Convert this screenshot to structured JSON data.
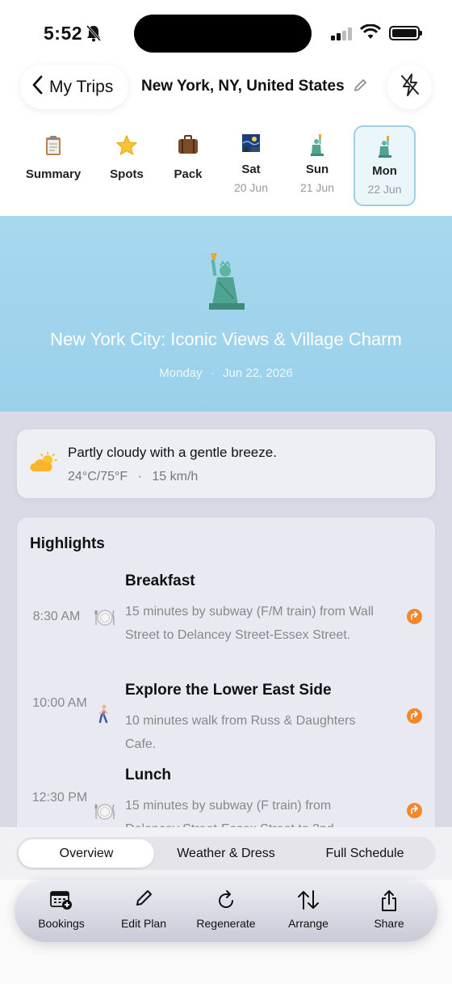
{
  "status_bar": {
    "time": "5:52"
  },
  "nav": {
    "back_label": "My Trips",
    "trip_title": "New York, NY, United States"
  },
  "tabs": [
    {
      "label": "Summary",
      "icon": "clipboard-icon"
    },
    {
      "label": "Spots",
      "icon": "star-icon"
    },
    {
      "label": "Pack",
      "icon": "suitcase-icon"
    },
    {
      "label": "Sat",
      "date": "20 Jun",
      "icon": "night-painting-icon"
    },
    {
      "label": "Sun",
      "date": "21 Jun",
      "icon": "statue-of-liberty-icon"
    },
    {
      "label": "Mon",
      "date": "22 Jun",
      "icon": "statue-of-liberty-icon",
      "active": true
    }
  ],
  "hero": {
    "title": "New York City: Iconic Views & Village Charm",
    "day": "Monday",
    "separator": "·",
    "date": "Jun 22, 2026",
    "background_color": "#9ad1ea"
  },
  "weather": {
    "description": "Partly cloudy with a gentle breeze.",
    "temperature": "24°C/75°F",
    "separator": "·",
    "wind": "15 km/h"
  },
  "highlights": {
    "title": "Highlights",
    "items": [
      {
        "time": "8:30 AM",
        "icon": "plate-icon",
        "name": "Breakfast",
        "description": "15 minutes by subway (F/M train) from Wall Street to Delancey Street-Essex Street."
      },
      {
        "time": "10:00 AM",
        "icon": "walking-person-icon",
        "name": "Explore the Lower East Side",
        "description": "10 minutes walk from Russ & Daughters Cafe."
      },
      {
        "time": "12:30 PM",
        "icon": "plate-icon",
        "name": "Lunch",
        "description": "15 minutes by subway (F train) from Delancey Street-Essex Street to 2nd"
      }
    ]
  },
  "segments": {
    "options": [
      "Overview",
      "Weather & Dress",
      "Full Schedule"
    ],
    "selected": "Overview"
  },
  "toolbar": {
    "bookings": "Bookings",
    "edit_plan": "Edit Plan",
    "regenerate": "Regenerate",
    "arrange": "Arrange",
    "share": "Share"
  },
  "colors": {
    "accent_orange": "#f5872b",
    "active_tab_border": "#9fcfe0",
    "content_bg": "#d9dae6"
  }
}
